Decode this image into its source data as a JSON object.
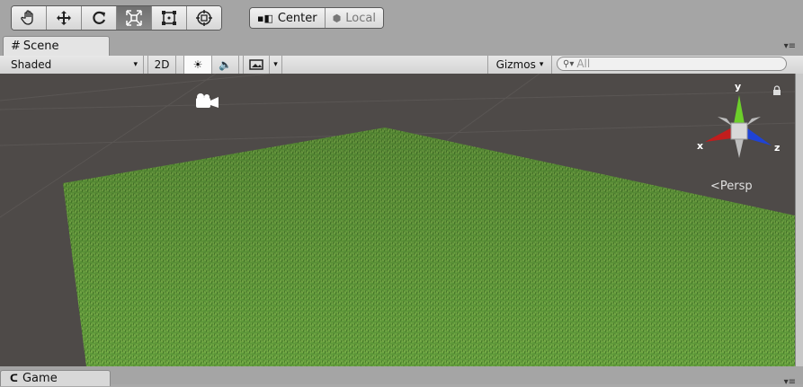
{
  "toolbar": {
    "tools": [
      {
        "name": "hand-tool-button",
        "icon": "hand-icon"
      },
      {
        "name": "move-tool-button",
        "icon": "move-arrows-icon"
      },
      {
        "name": "rotate-tool-button",
        "icon": "rotate-icon"
      },
      {
        "name": "scale-tool-button",
        "icon": "scale-icon",
        "active": true
      },
      {
        "name": "rect-tool-button",
        "icon": "rect-transform-icon"
      },
      {
        "name": "transform-tool-button",
        "icon": "transform-icon"
      }
    ],
    "pivot": {
      "center_label": "Center",
      "local_label": "Local"
    }
  },
  "scene_tab": {
    "label": "Scene"
  },
  "scene_toolbar": {
    "shading_mode": "Shaded",
    "mode_2d": "2D",
    "gizmos_label": "Gizmos",
    "search_placeholder": "All"
  },
  "viewport": {
    "gizmo_axes": {
      "y": "y",
      "x": "x",
      "z": "z"
    },
    "projection_label": "Persp",
    "colors": {
      "ground": "#4e4a48",
      "grass": "#5f9a3a",
      "x_axis": "#c21d1d",
      "y_axis": "#6ccf2a",
      "z_axis": "#1f43d6"
    }
  },
  "game_tab": {
    "label": "Game"
  }
}
